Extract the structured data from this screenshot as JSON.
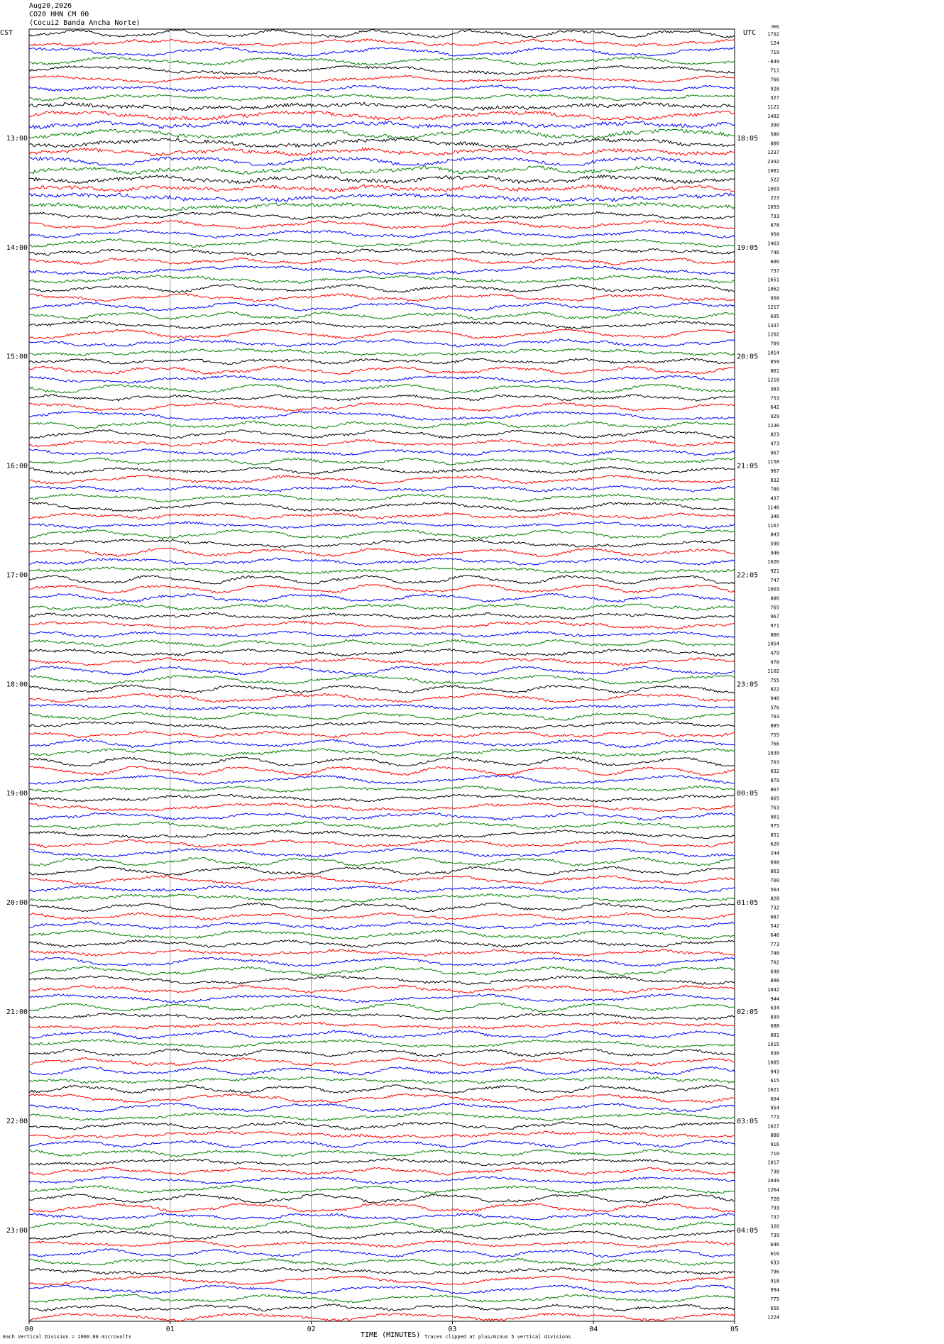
{
  "header": {
    "date": "Aug20,2026",
    "station": "CO20 HHN CM 00",
    "location": "(Cocui2 Banda Ancha Norte)"
  },
  "left_axis_title": "CST",
  "right_axis_title": "UTC",
  "right_top_label": "RMS",
  "footer": {
    "scale_note": "Each Vertical Division = 1000.00 microvolts",
    "xlabel": "TIME (MINUTES)",
    "clip_note": "Traces clipped at plus/minus 5 vertical divisions"
  },
  "chart_data": {
    "type": "line",
    "title": "",
    "xlabel": "TIME (MINUTES)",
    "ylabel": "",
    "x_ticks": [
      "00",
      "01",
      "02",
      "03",
      "04",
      "05"
    ],
    "xlim": [
      0,
      5
    ],
    "grid": true,
    "trace_colors": [
      "#000000",
      "#ff0000",
      "#0000ff",
      "#008000"
    ],
    "cst_labels": [
      "13:00",
      "14:00",
      "15:00",
      "16:00",
      "17:00",
      "18:00",
      "19:00",
      "20:00",
      "21:00",
      "22:00",
      "23:00"
    ],
    "utc_labels": [
      "18:05",
      "19:05",
      "20:05",
      "21:05",
      "22:05",
      "23:05",
      "00:05",
      "01:05",
      "02:05",
      "03:05",
      "04:05"
    ],
    "rms_values": [
      "1792",
      "124",
      "719",
      "-849",
      "711",
      "766",
      "928",
      "327",
      "1121",
      "1482",
      "390",
      "580",
      "800",
      "1237",
      "2392",
      "1081",
      "522",
      "1003",
      "223",
      "1093",
      "733",
      "878",
      "958",
      "1463",
      "746",
      "606",
      "737",
      "1651",
      "1062",
      "958",
      "1217",
      "695",
      "1337",
      "1202",
      "709",
      "1014",
      "859",
      "801",
      "1218",
      "383",
      "753",
      "642",
      "929",
      "1230",
      "823",
      "473",
      "967",
      "1158",
      "967",
      "832",
      "780",
      "437",
      "1146",
      "346",
      "1167",
      "843",
      "590",
      "946",
      "1026",
      "921",
      "747",
      "1003",
      "886",
      "765",
      "967",
      "971",
      "800",
      "1054",
      "479",
      "978",
      "1102",
      "755",
      "822",
      "946",
      "576",
      "703",
      "885",
      "755",
      "766",
      "1039",
      "703",
      "832",
      "879",
      "867",
      "665",
      "763",
      "901",
      "975",
      "851",
      "620",
      "244",
      "698",
      "863",
      "700",
      "564",
      "828",
      "732",
      "687",
      "542",
      "640",
      "773",
      "748",
      "702",
      "698",
      "898",
      "1042",
      "944",
      "634",
      "839",
      "688",
      "881",
      "1015",
      "938",
      "1085",
      "943",
      "615",
      "1021",
      "604",
      "954",
      "773",
      "1027",
      "888",
      "916",
      "710",
      "1017",
      "738",
      "1049",
      "1264",
      "728",
      "793",
      "737",
      "326",
      "739",
      "646",
      "616",
      "633",
      "796",
      "918",
      "994",
      "775",
      "656",
      "1224"
    ]
  }
}
